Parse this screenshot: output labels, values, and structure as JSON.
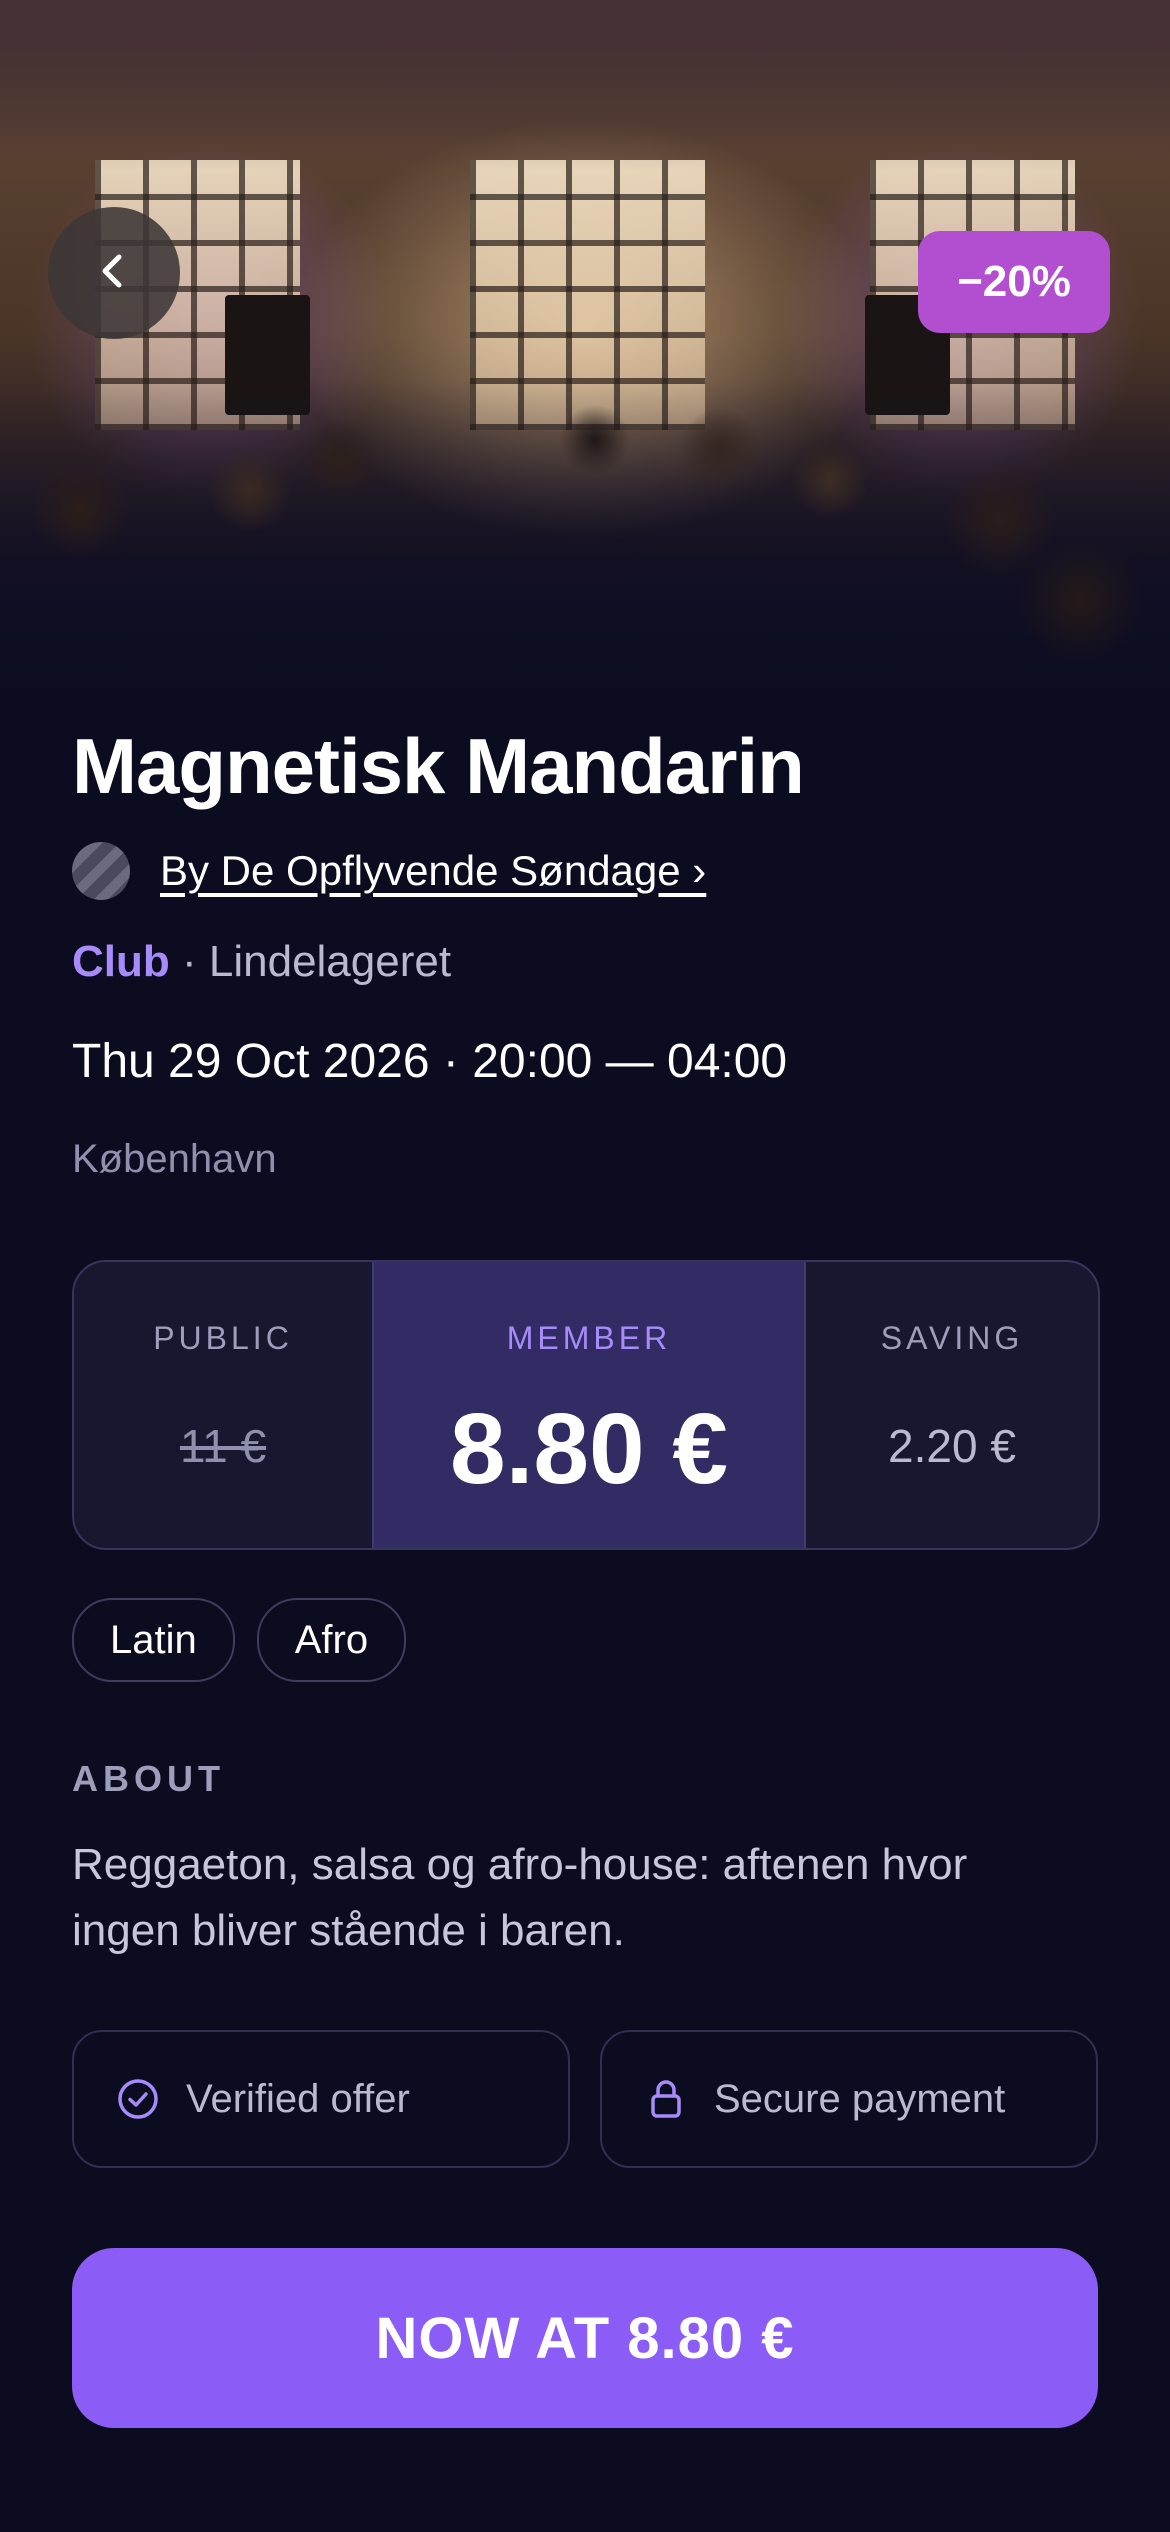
{
  "hero": {
    "discount_badge": "−20%"
  },
  "event": {
    "title": "Magnetisk Mandarin",
    "organizer": "By De Opflyvende Søndage ›",
    "category": "Club",
    "separator": " · ",
    "venue": "Lindelageret",
    "datetime": "Thu 29 Oct 2026 · 20:00 — 04:00",
    "city": "København"
  },
  "pricing": {
    "public_label": "PUBLIC",
    "public_price": "11 €",
    "member_label": "MEMBER",
    "member_price": "8.80 €",
    "saving_label": "SAVING",
    "saving_value": "2.20 €"
  },
  "tags": [
    "Latin",
    "Afro"
  ],
  "about": {
    "heading": "ABOUT",
    "text": "Reggaeton, salsa og afro-house: aftenen hvor ingen bliver stående i baren."
  },
  "badges": {
    "verified": "Verified offer",
    "secure": "Secure payment"
  },
  "cta": {
    "label": "NOW AT 8.80 €"
  },
  "colors": {
    "background": "#0c0c21",
    "accent": "#8b5cf6",
    "accent_text": "#a78bfa",
    "discount_badge": "#b24fd0",
    "member_panel": "#332b63"
  },
  "icons": {
    "back": "chevron-left-icon",
    "verified": "check-circle-icon",
    "secure": "lock-icon"
  }
}
